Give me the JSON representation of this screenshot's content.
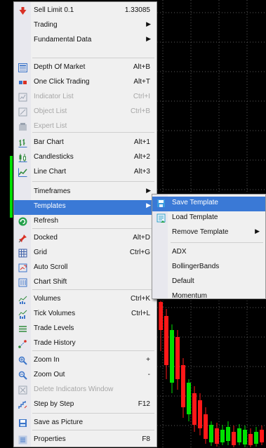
{
  "menu": {
    "items": [
      {
        "label": "Sell Limit 0.1",
        "shortcut": "1.33085",
        "icon": "sell-arrow-icon",
        "color": "#d93025"
      },
      {
        "label": "Trading",
        "submenu": true
      },
      {
        "label": "Fundamental Data",
        "submenu": true
      },
      {
        "label": "Depth Of Market",
        "shortcut": "Alt+B",
        "icon": "depth-of-market-icon",
        "color": "#3b74c9"
      },
      {
        "label": "One Click Trading",
        "shortcut": "Alt+T",
        "icon": "one-click-trading-icon",
        "color": "#d93025"
      },
      {
        "label": "Indicator List",
        "shortcut": "Ctrl+I",
        "icon": "indicator-list-icon",
        "disabled": true,
        "color": "#9aa3b0"
      },
      {
        "label": "Object List",
        "shortcut": "Ctrl+B",
        "icon": "object-list-icon",
        "disabled": true,
        "color": "#9aa3b0"
      },
      {
        "label": "Expert List",
        "icon": "expert-list-icon",
        "disabled": true,
        "color": "#9aa3b0"
      },
      {
        "label": "Bar Chart",
        "shortcut": "Alt+1",
        "icon": "bar-chart-icon",
        "color": "#2f8a3c"
      },
      {
        "label": "Candlesticks",
        "shortcut": "Alt+2",
        "icon": "candlesticks-icon",
        "color": "#2f8a3c"
      },
      {
        "label": "Line Chart",
        "shortcut": "Alt+3",
        "icon": "line-chart-icon",
        "color": "#2f8a3c"
      },
      {
        "label": "Timeframes",
        "submenu": true
      },
      {
        "label": "Templates",
        "submenu": true,
        "highlighted": true
      },
      {
        "label": "Refresh",
        "icon": "refresh-icon",
        "color": "#22a04b"
      },
      {
        "label": "Docked",
        "shortcut": "Alt+D",
        "icon": "pin-icon",
        "color": "#d93025"
      },
      {
        "label": "Grid",
        "shortcut": "Ctrl+G",
        "icon": "grid-icon",
        "color": "#3b5ea8"
      },
      {
        "label": "Auto Scroll",
        "icon": "auto-scroll-icon",
        "color": "#3b74c9"
      },
      {
        "label": "Chart Shift",
        "icon": "chart-shift-icon",
        "color": "#3b74c9"
      },
      {
        "label": "Volumes",
        "shortcut": "Ctrl+K",
        "icon": "volumes-icon",
        "color": "#2f8a3c"
      },
      {
        "label": "Tick Volumes",
        "shortcut": "Ctrl+L",
        "icon": "tick-volumes-icon",
        "color": "#2f8a3c"
      },
      {
        "label": "Trade Levels",
        "icon": "trade-levels-icon",
        "color": "#2f8a3c"
      },
      {
        "label": "Trade History",
        "icon": "trade-history-icon",
        "color": "#3b74c9"
      },
      {
        "label": "Zoom In",
        "shortcut": "+",
        "icon": "zoom-in-icon",
        "color": "#3b74c9"
      },
      {
        "label": "Zoom Out",
        "shortcut": "-",
        "icon": "zoom-out-icon",
        "color": "#3b74c9"
      },
      {
        "label": "Delete Indicators Window",
        "icon": "delete-indicators-window-icon",
        "disabled": true,
        "color": "#9aa3b0"
      },
      {
        "label": "Step by Step",
        "shortcut": "F12",
        "icon": "step-by-step-icon",
        "color": "#3b74c9"
      },
      {
        "label": "Save as Picture",
        "icon": "save-as-picture-icon",
        "color": "#3b74c9"
      },
      {
        "label": "Properties",
        "shortcut": "F8",
        "icon": "properties-icon",
        "color": "#3b74c9"
      }
    ]
  },
  "submenu": {
    "items": [
      {
        "label": "Save Template",
        "icon": "save-template-icon",
        "highlighted": true,
        "color": "#3b9be0"
      },
      {
        "label": "Load Template",
        "icon": "load-template-icon",
        "color": "#2fa0c8"
      },
      {
        "label": "Remove Template",
        "submenu": true
      },
      {
        "label": "ADX"
      },
      {
        "label": "BollingerBands"
      },
      {
        "label": "Default"
      },
      {
        "label": "Momentum"
      }
    ]
  },
  "chart": {
    "background": "#000000",
    "grid_color": "#5a5a5a",
    "bull_color": "#00e000",
    "bear_color": "#ff1818"
  }
}
